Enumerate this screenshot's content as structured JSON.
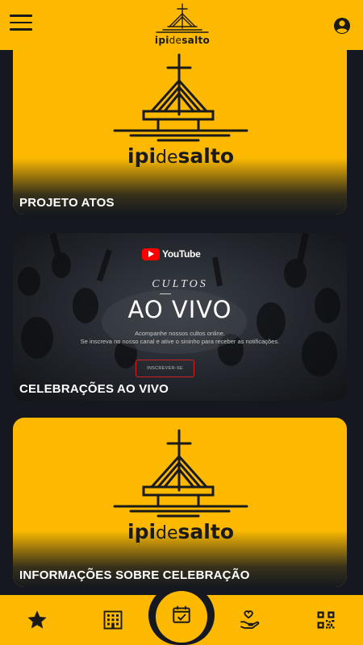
{
  "header": {
    "logo": {
      "text_left": "ipi",
      "text_mid": "de",
      "text_right": "salto"
    },
    "menu_icon": "hamburger-menu-icon",
    "account_icon": "account-circle-icon"
  },
  "cards": [
    {
      "title": "PROJETO ATOS",
      "logo": {
        "text_left": "ipi",
        "text_mid": "de",
        "text_right": "salto"
      }
    },
    {
      "title": "CELEBRAÇÕES AO VIVO",
      "banner": {
        "platform": "YouTube",
        "cultos": "CULTOS",
        "headline": "AO VIVO",
        "line1": "Acompanhe nossos cultos online.",
        "line2": "Se inscreva no nosso canal e ative o sininho para receber as notificações.",
        "button": "INSCREVER-SE"
      }
    },
    {
      "title": "INFORMAÇÕES SOBRE CELEBRAÇÃO",
      "logo": {
        "text_left": "ipi",
        "text_mid": "de",
        "text_right": "salto"
      }
    }
  ],
  "bottom_nav": [
    {
      "icon": "star-icon"
    },
    {
      "icon": "building-icon"
    },
    {
      "icon": "calendar-check-icon"
    },
    {
      "icon": "heart-hand-icon"
    },
    {
      "icon": "qr-code-icon"
    }
  ],
  "colors": {
    "accent": "#fcb900",
    "background": "#15191f",
    "text_dark": "#1a1a1a",
    "youtube_red": "#ff0000"
  }
}
